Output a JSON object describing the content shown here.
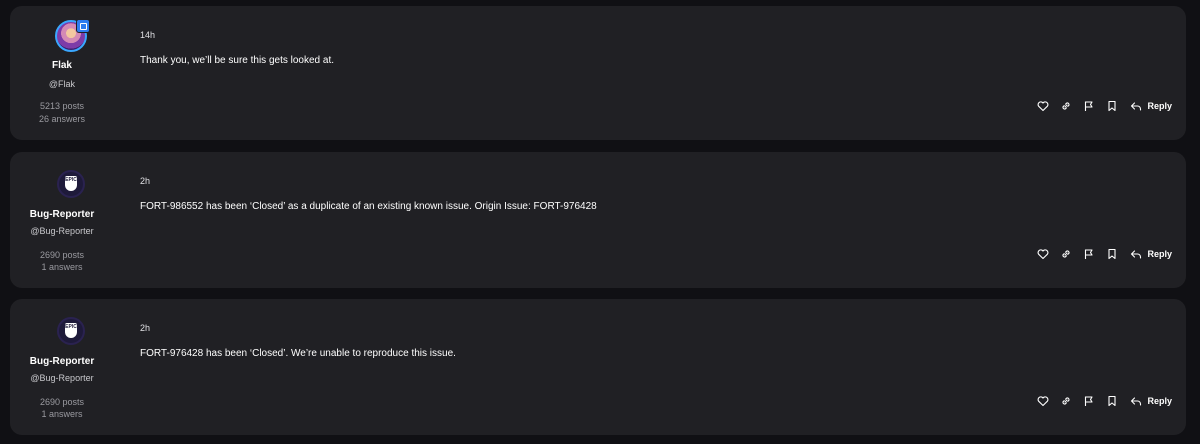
{
  "posts": [
    {
      "author": {
        "name": "Flak",
        "handle": "@Flak",
        "posts": "5213 posts",
        "answers": "26 answers",
        "avatar_icon": "user-avatar"
      },
      "time": "14h",
      "message": "Thank you, we’ll be sure this gets looked at.",
      "reply_label": "Reply"
    },
    {
      "author": {
        "name": "Bug-Reporter",
        "handle": "@Bug-Reporter",
        "posts": "2690 posts",
        "answers": "1 answers",
        "avatar_icon": "epic-games-logo"
      },
      "time": "2h",
      "message": "FORT-986552 has been ‘Closed’ as a duplicate of an existing known issue. Origin Issue: FORT-976428",
      "reply_label": "Reply"
    },
    {
      "author": {
        "name": "Bug-Reporter",
        "handle": "@Bug-Reporter",
        "posts": "2690 posts",
        "answers": "1 answers",
        "avatar_icon": "epic-games-logo"
      },
      "time": "2h",
      "message": "FORT-976428 has been ‘Closed’. We’re unable to reproduce this issue.",
      "reply_label": "Reply"
    }
  ],
  "action_icons": [
    "heart-icon",
    "link-icon",
    "flag-icon",
    "bookmark-icon",
    "reply-icon"
  ],
  "colors": {
    "background": "#101014",
    "card": "#202024",
    "text": "#ffffff",
    "muted": "#9a9aa0",
    "avatar_ring": "#3aa7ff"
  }
}
